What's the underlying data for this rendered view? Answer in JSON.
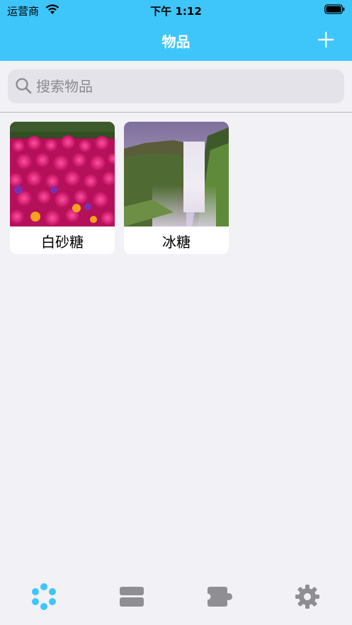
{
  "status_bar": {
    "carrier": "运营商",
    "time": "下午 1:12"
  },
  "nav": {
    "title": "物品",
    "add_icon": "plus-icon"
  },
  "search": {
    "placeholder": "搜索物品",
    "value": ""
  },
  "items": [
    {
      "name": "白砂糖",
      "image": "pink-flowers-photo"
    },
    {
      "name": "冰糖",
      "image": "waterfall-photo"
    }
  ],
  "tabbar": {
    "tabs": [
      {
        "icon": "dots-cluster-icon",
        "selected": true
      },
      {
        "icon": "storage-rows-icon",
        "selected": false
      },
      {
        "icon": "puzzle-piece-icon",
        "selected": false
      },
      {
        "icon": "gear-icon",
        "selected": false
      }
    ]
  },
  "colors": {
    "accent": "#3ec6fb",
    "background": "#f2f1f6",
    "inactive_tab": "#8e8e93"
  }
}
